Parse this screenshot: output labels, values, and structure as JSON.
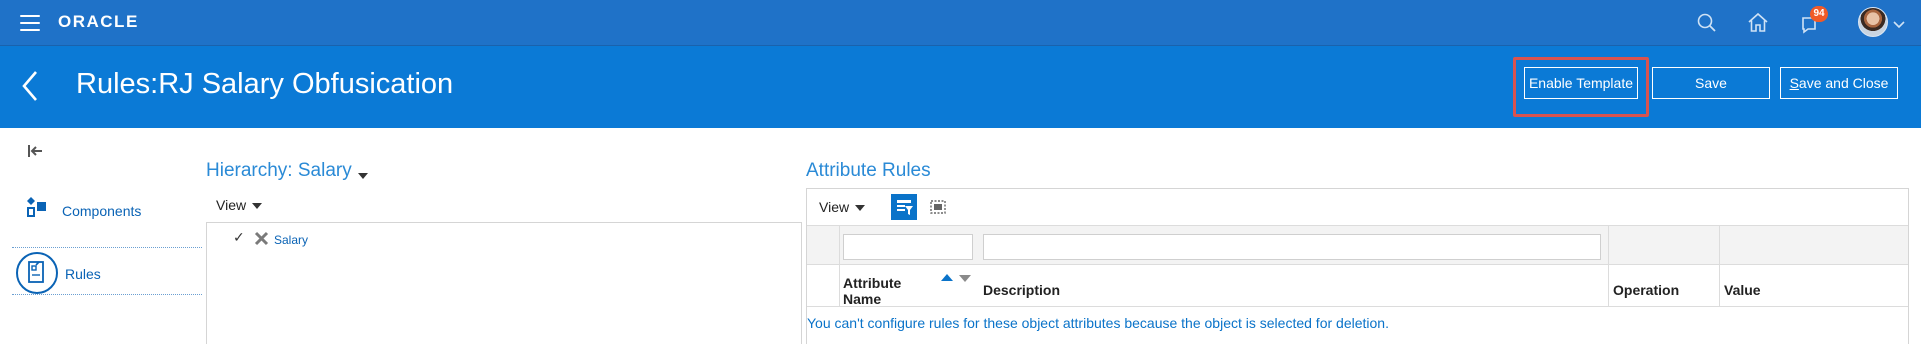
{
  "header": {
    "logo_text": "ORACLE",
    "notification_count": "94",
    "icons": [
      "menu-icon",
      "search-icon",
      "home-icon",
      "notifications-icon",
      "user-avatar",
      "chevron-down-icon"
    ]
  },
  "titlebar": {
    "title": "Rules:RJ Salary Obfusication",
    "buttons": {
      "enable_template": "Enable Template",
      "save": "Save",
      "save_and_close": "Save and Close"
    },
    "highlight_color": "#d9534f"
  },
  "sidebar": {
    "items": [
      {
        "label": "Components",
        "icon": "components-icon"
      },
      {
        "label": "Rules",
        "icon": "rules-icon",
        "selected": true
      }
    ]
  },
  "hierarchy": {
    "title": "Hierarchy: Salary",
    "view_label": "View",
    "tree": [
      {
        "label": "Salary",
        "checked": true,
        "marked_for_deletion": true
      }
    ]
  },
  "attribute_rules": {
    "title": "Attribute Rules",
    "view_label": "View",
    "filters": {
      "attribute_name": "",
      "description": ""
    },
    "columns": [
      "Attribute Name",
      "Description",
      "Operation",
      "Value"
    ],
    "empty_message": "You can't configure rules for these object attributes because the object is selected for deletion."
  },
  "colors": {
    "header_blue": "#1f72c8",
    "title_blue": "#0b7ad6",
    "link_blue": "#0a63b5",
    "accent_orange": "#f05a28"
  }
}
